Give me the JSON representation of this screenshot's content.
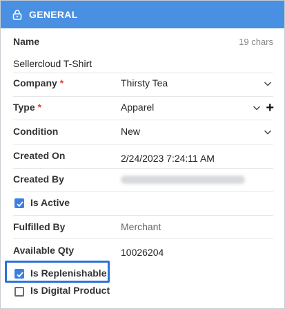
{
  "header": {
    "title": "GENERAL",
    "icon": "lock-icon"
  },
  "fields": {
    "name": {
      "label": "Name",
      "value": "Sellercloud T-Shirt",
      "char_count": "19 chars"
    },
    "company": {
      "label": "Company",
      "required_mark": "*",
      "value": "Thirsty Tea"
    },
    "type": {
      "label": "Type",
      "required_mark": "*",
      "value": "Apparel",
      "add_symbol": "+"
    },
    "condition": {
      "label": "Condition",
      "value": "New"
    },
    "created_on": {
      "label": "Created On",
      "value": "2/24/2023 7:24:11 AM"
    },
    "created_by": {
      "label": "Created By"
    },
    "is_active": {
      "label": "Is Active",
      "checked": true
    },
    "fulfilled_by": {
      "label": "Fulfilled By",
      "value": "Merchant"
    },
    "available_qty": {
      "label": "Available Qty",
      "value": "10026204"
    },
    "is_replenishable": {
      "label": "Is Replenishable",
      "checked": true
    },
    "is_digital_product": {
      "label": "Is Digital Product",
      "checked": false
    }
  },
  "colors": {
    "header_bg": "#4a90e2",
    "checkbox_checked": "#3d7fe0",
    "highlight": "#2d72d9",
    "required": "#e0453a"
  }
}
